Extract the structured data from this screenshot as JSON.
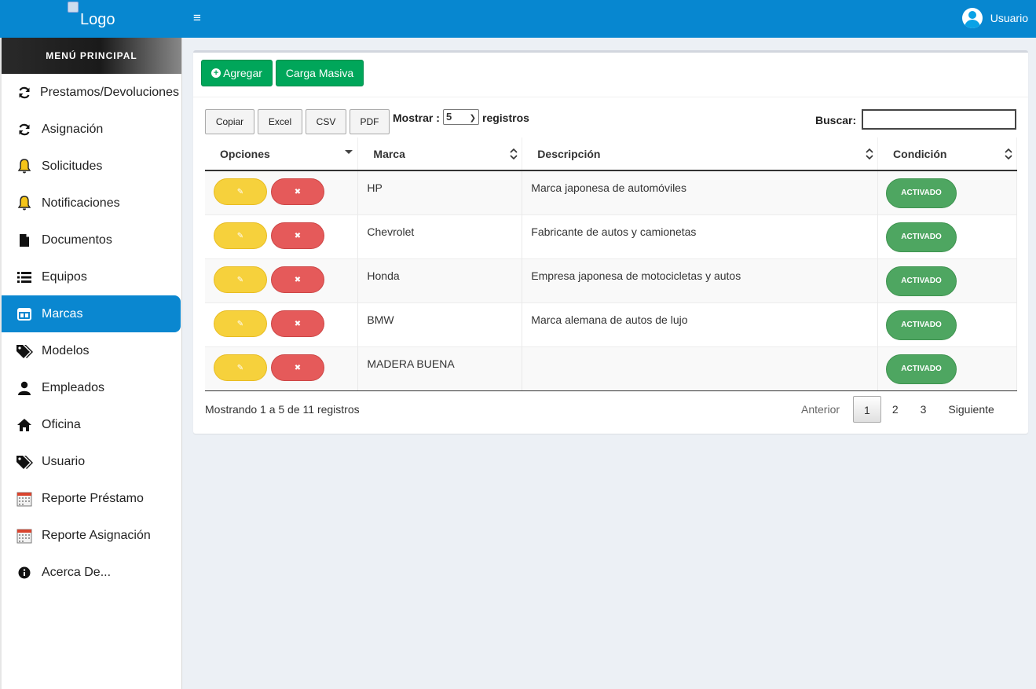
{
  "header": {
    "logo_alt": "Logo",
    "menu_toggle": "≡",
    "user_name": "Usuario"
  },
  "sidebar": {
    "title": "MENÚ PRINCIPAL",
    "active_item": "Marcas",
    "items": [
      {
        "label": "Prestamos/Devoluciones",
        "icon": "refresh-icon"
      },
      {
        "label": "Asignación",
        "icon": "refresh-icon"
      },
      {
        "label": "Solicitudes",
        "icon": "bell-icon"
      },
      {
        "label": "Notificaciones",
        "icon": "bell-icon"
      },
      {
        "label": "Documentos",
        "icon": "document-icon"
      },
      {
        "label": "Equipos",
        "icon": "list-icon"
      },
      {
        "label": "Marcas",
        "icon": "window-icon"
      },
      {
        "label": "Modelos",
        "icon": "tags-icon"
      },
      {
        "label": "Empleados",
        "icon": "user-icon"
      },
      {
        "label": "Oficina",
        "icon": "home-icon"
      },
      {
        "label": "Usuario",
        "icon": "tags-icon"
      },
      {
        "label": "Reporte Préstamo",
        "icon": "calendar-icon"
      },
      {
        "label": "Reporte Asignación",
        "icon": "calendar-icon"
      },
      {
        "label": "Acerca De...",
        "icon": "info-icon"
      }
    ]
  },
  "toolbar": {
    "add_label": "Agregar",
    "bulk_label": "Carga Masiva"
  },
  "datatable": {
    "export_buttons": [
      "Copiar",
      "Excel",
      "CSV",
      "PDF"
    ],
    "show_label": "Mostrar :",
    "show_value": "5",
    "show_suffix": "registros",
    "search_label": "Buscar:",
    "search_value": "",
    "columns": [
      "Opciones",
      "Marca",
      "Descripción",
      "Condición"
    ],
    "rows": [
      {
        "marca": "HP",
        "descripcion": "Marca japonesa de automóviles",
        "condicion": "ACTIVADO"
      },
      {
        "marca": "Chevrolet",
        "descripcion": "Fabricante de autos y camionetas",
        "condicion": "ACTIVADO"
      },
      {
        "marca": "Honda",
        "descripcion": "Empresa japonesa de motocicletas y autos",
        "condicion": "ACTIVADO"
      },
      {
        "marca": "BMW",
        "descripcion": "Marca alemana de autos de lujo",
        "condicion": "ACTIVADO"
      },
      {
        "marca": "MADERA BUENA",
        "descripcion": "",
        "condicion": "ACTIVADO"
      }
    ],
    "edit_glyph": "✎",
    "delete_glyph": "✖",
    "info": "Mostrando 1 a 5 de 11 registros",
    "pagination": {
      "prev": "Anterior",
      "pages": [
        "1",
        "2",
        "3"
      ],
      "current": "1",
      "next": "Siguiente"
    }
  },
  "colors": {
    "primary": "#0787d0",
    "success": "#00a65a",
    "warning": "#f6d13c",
    "danger": "#e55a5a",
    "badge": "#4ea661"
  }
}
